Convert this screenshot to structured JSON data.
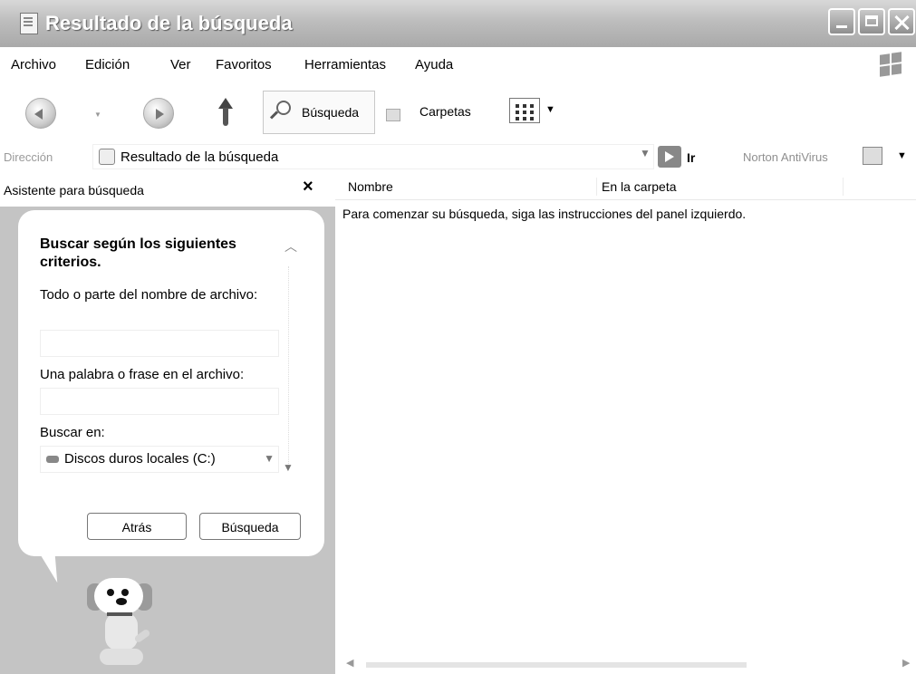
{
  "window": {
    "title": "Resultado de la búsqueda"
  },
  "menu": {
    "items": [
      "Archivo",
      "Edición",
      "Ver",
      "Favoritos",
      "Herramientas",
      "Ayuda"
    ]
  },
  "toolbar": {
    "search_label": "Búsqueda",
    "folders_label": "Carpetas"
  },
  "address": {
    "label": "Dirección",
    "value": "Resultado de la búsqueda",
    "go_label": "Ir",
    "norton_label": "Norton AntiVirus"
  },
  "left_panel": {
    "title": "Asistente para búsqueda",
    "close_glyph": "×",
    "criteria_title": "Buscar según los siguientes criterios.",
    "filename_label": "Todo o parte del nombre de archivo:",
    "filename_value": "",
    "phrase_label": "Una palabra o frase en el archivo:",
    "phrase_value": "",
    "lookin_label": "Buscar en:",
    "lookin_value": "Discos duros locales (C:)",
    "back_button": "Atrás",
    "search_button": "Búsqueda"
  },
  "results": {
    "columns": [
      "Nombre",
      "En la carpeta"
    ],
    "hint": "Para comenzar su búsqueda, siga las instrucciones del panel izquierdo."
  },
  "icons": {
    "app": "folder-search-icon",
    "back": "back-arrow-icon",
    "forward": "forward-arrow-icon",
    "up": "up-folder-icon",
    "search": "magnifier-icon",
    "folders": "folders-icon",
    "views": "views-icon",
    "address": "search-results-icon",
    "go": "go-arrow-icon",
    "norton": "norton-antivirus-icon",
    "assistant": "search-dog-icon"
  }
}
